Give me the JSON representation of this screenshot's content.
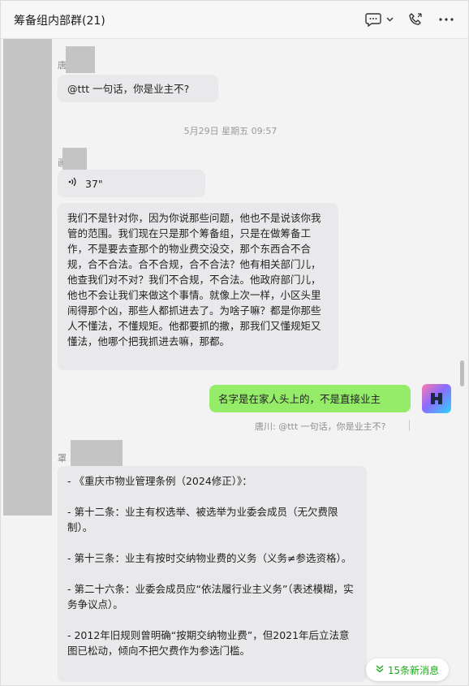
{
  "header": {
    "title": "筹备组内部群(21)",
    "icons": [
      "chat-bubble-icon",
      "chevron-down-icon",
      "phone-icon",
      "more-icon"
    ]
  },
  "messages": [
    {
      "sender": "唐",
      "text": "@ttt 一句话，你是业主不?"
    },
    {
      "timestamp": "5月29日 星期五 09:57"
    },
    {
      "sender": "画",
      "voice_duration": "37\""
    },
    {
      "text": "我们不是针对你，因为你说那些问题，他也不是说该你我管的范围。我们现在只是那个筹备组，只是在做筹备工作，不是要去查那个的物业费交没交，那个东西合不合规，合不合法。合不合规，合不合法？他有相关部门儿，他查我们对不对？我们不合规，不合法。他政府部门儿，他也不会让我们来做这个事情。就像上次一样，小区头里闹得那个凶，那些人都抓进去了。为啥子嘛？都是你那些人不懂法，不懂规矩。他都要抓的撒，那我们又懂规矩又懂法，他哪个把我抓进去嘛，那都。"
    },
    {
      "self": true,
      "text": "名字是在家人头上的，不是直接业主",
      "quote": "唐川: @ttt 一句话，你是业主不?"
    },
    {
      "sender": "罩",
      "lines": [
        "- 《重庆市物业管理条例（2024修正）》：",
        "",
        "- 第十二条：业主有权选举、被选举为业委会成员（无欠费限制）。",
        "",
        "- 第十三条：业主有按时交纳物业费的义务（义务≠参选资格）。",
        "",
        "- 第二十六条：业委会成员应“依法履行业主义务”（表述模糊，实务争议点）。",
        "",
        "- 2012年旧规则曾明确“按期交纳物业费”，但2021年后立法意图已松动，倾向不把欠费作为参选门槛。"
      ]
    }
  ],
  "new_messages_badge": "15条新消息",
  "colors": {
    "self_bubble": "#95ec69",
    "other_bubble": "#e9e9eb",
    "accent": "#1aad19"
  }
}
